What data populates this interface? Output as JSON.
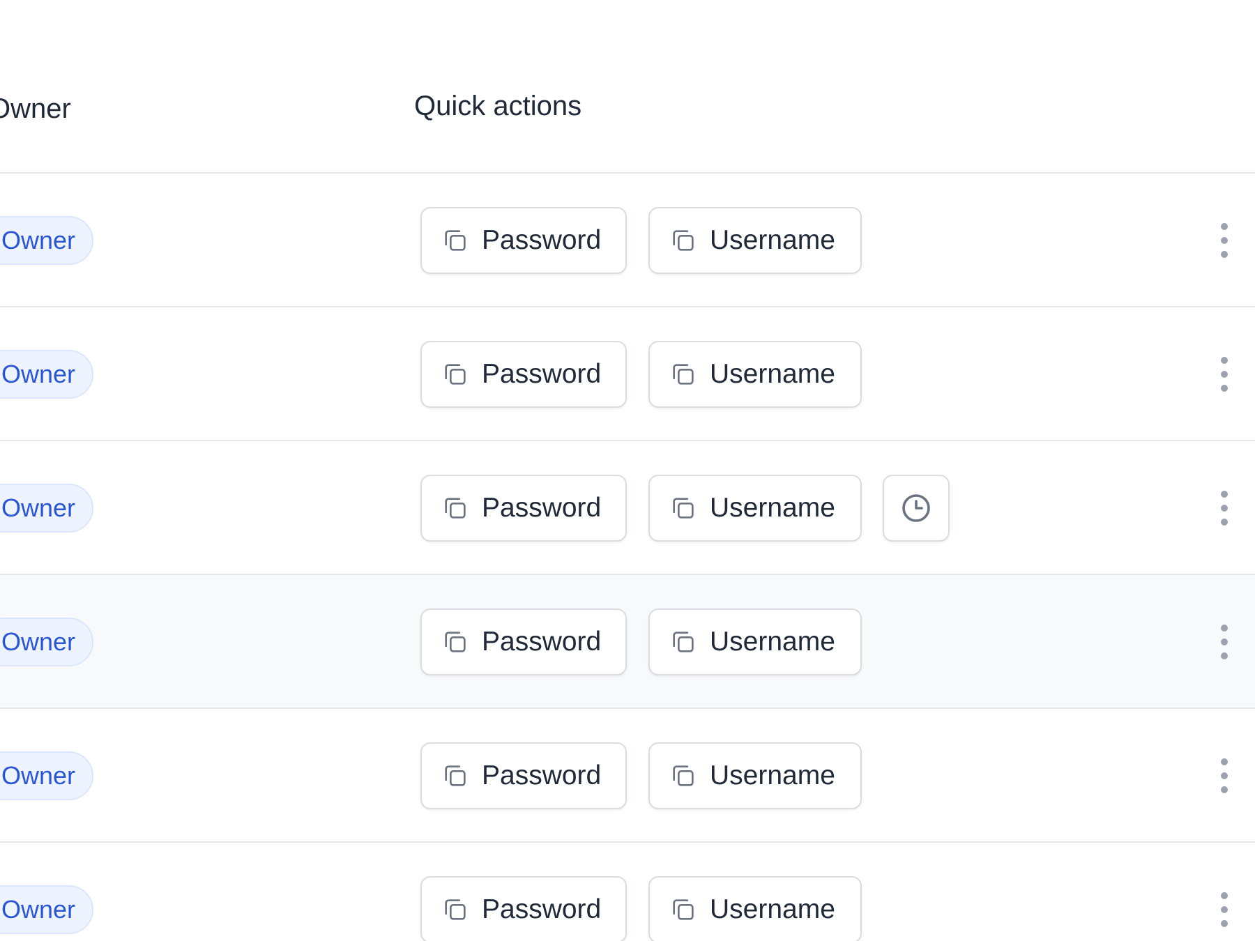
{
  "header": {
    "owner_label": "Owner",
    "actions_label": "Quick actions"
  },
  "rows": [
    {
      "owner": "Owner",
      "password_label": "Password",
      "username_label": "Username",
      "history": false,
      "highlighted": false
    },
    {
      "owner": "Owner",
      "password_label": "Password",
      "username_label": "Username",
      "history": false,
      "highlighted": false
    },
    {
      "owner": "Owner",
      "password_label": "Password",
      "username_label": "Username",
      "history": true,
      "highlighted": false
    },
    {
      "owner": "Owner",
      "password_label": "Password",
      "username_label": "Username",
      "history": false,
      "highlighted": true
    },
    {
      "owner": "Owner",
      "password_label": "Password",
      "username_label": "Username",
      "history": false,
      "highlighted": false
    },
    {
      "owner": "Owner",
      "password_label": "Password",
      "username_label": "Username",
      "history": false,
      "highlighted": false
    }
  ],
  "icons": {
    "copy": "copy-icon",
    "history": "clock-icon",
    "more": "more-vertical-icon"
  },
  "colors": {
    "badge_text": "#2a56d6",
    "badge_bg": "#eef4ff",
    "border": "#d9dce3",
    "divider": "#e5e7eb",
    "highlight_row": "#f8f9fb",
    "icon_gray": "#6b7280",
    "kebab_gray": "#9ca3af"
  }
}
